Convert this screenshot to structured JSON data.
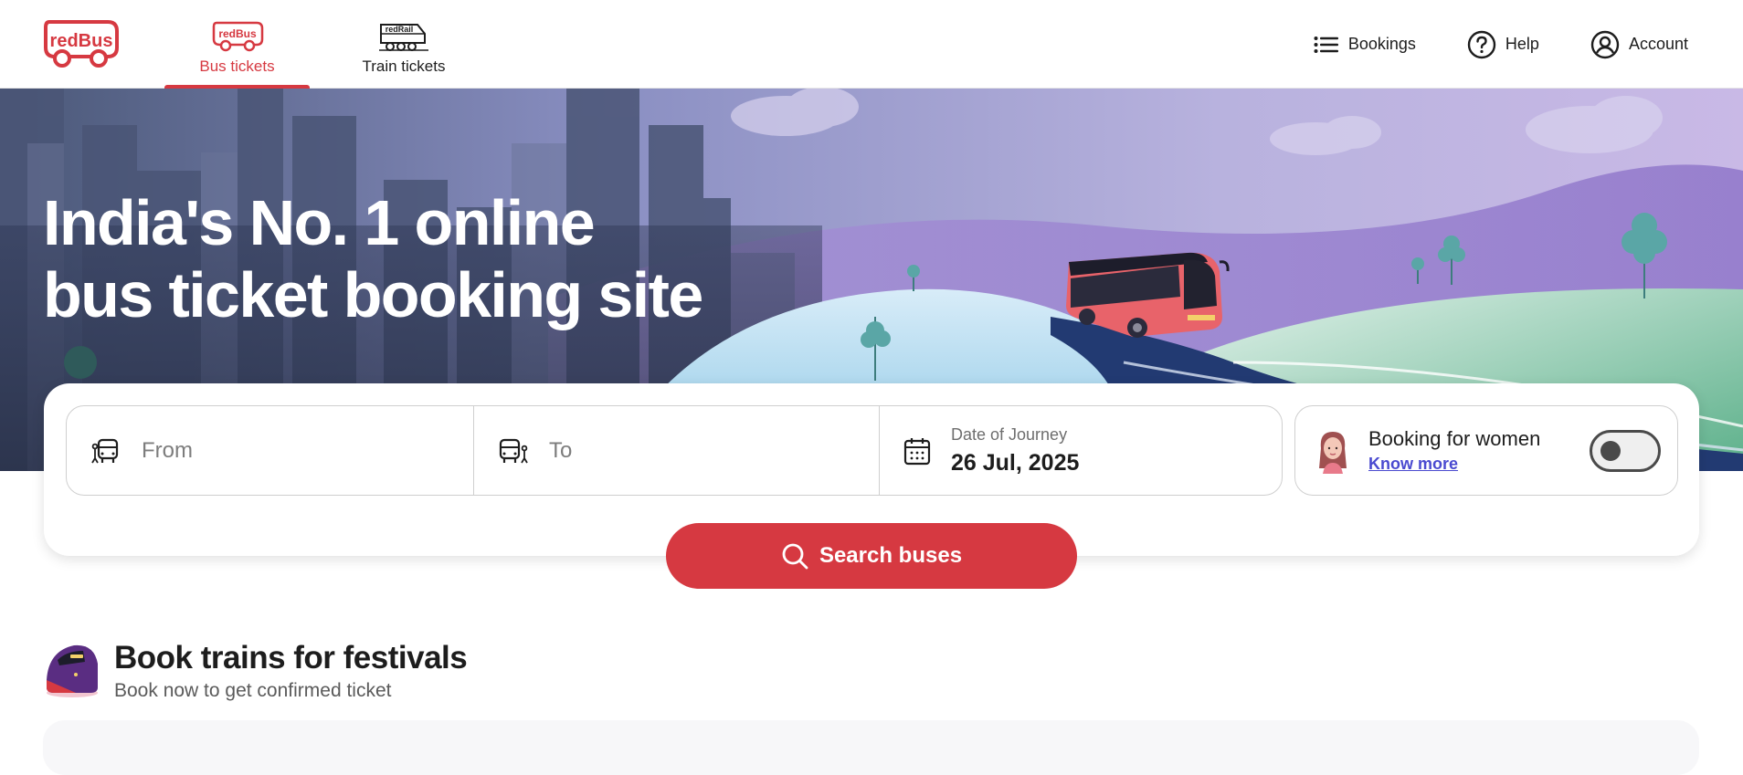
{
  "header": {
    "logo_text": "redBus",
    "tabs": [
      {
        "label": "Bus tickets",
        "icon": "bus-icon",
        "badge": "redBus",
        "active": true
      },
      {
        "label": "Train tickets",
        "icon": "train-icon",
        "badge": "redRail",
        "active": false
      }
    ],
    "nav": [
      {
        "label": "Bookings",
        "icon": "list-icon"
      },
      {
        "label": "Help",
        "icon": "help-icon"
      },
      {
        "label": "Account",
        "icon": "account-icon"
      }
    ]
  },
  "hero": {
    "title_line1": "India's No. 1 online",
    "title_line2": "bus ticket booking site"
  },
  "search": {
    "from_placeholder": "From",
    "to_placeholder": "To",
    "date_label": "Date of Journey",
    "date_value": "26 Jul, 2025",
    "women_title": "Booking for women",
    "women_link": "Know more",
    "women_toggle_on": false,
    "button_label": "Search buses"
  },
  "festival": {
    "title": "Book trains for festivals",
    "subtitle": "Book now to get confirmed ticket"
  },
  "colors": {
    "brand_red": "#d63941",
    "link_blue": "#4a4ad0"
  }
}
